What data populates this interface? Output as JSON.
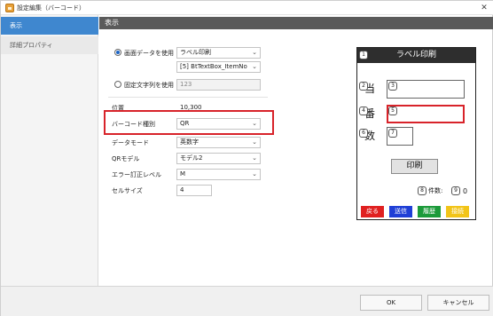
{
  "window": {
    "title": "設定編集（バーコード）",
    "close_glyph": "✕"
  },
  "sidebar": {
    "items": [
      {
        "label": "表示"
      },
      {
        "label": "詳細プロパティ"
      }
    ]
  },
  "section": {
    "title": "表示"
  },
  "form": {
    "use_screen_data": {
      "label": "画面データを使用",
      "selected": true,
      "screen_value": "ラベル印刷",
      "item_value": "[5] BtTextBox_ItemNo"
    },
    "use_fixed_string": {
      "label": "固定文字列を使用",
      "selected": false,
      "value": "123"
    },
    "position": {
      "label": "位置",
      "value": "10,300"
    },
    "barcode_type": {
      "label": "バーコード種別",
      "value": "QR"
    },
    "data_mode": {
      "label": "データモード",
      "value": "英数字"
    },
    "qr_model": {
      "label": "QRモデル",
      "value": "モデル2"
    },
    "error_correction": {
      "label": "エラー訂正レベル",
      "value": "M"
    },
    "cell_size": {
      "label": "セルサイズ",
      "value": "4"
    },
    "caret": "⌄"
  },
  "preview": {
    "title": "ラベル印刷",
    "header_num": "1",
    "rows": [
      {
        "num_label": "2",
        "label": "当",
        "num_box": "3"
      },
      {
        "num_label": "4",
        "label": "番",
        "num_box": "5"
      },
      {
        "num_label": "6",
        "label": "数",
        "num_box": "7"
      }
    ],
    "print_label": "印刷",
    "count_num": "8",
    "count_label": "件数:",
    "count_value_num": "9",
    "count_value": "0",
    "footer_buttons": [
      {
        "label": "戻る",
        "color": "#e02020"
      },
      {
        "label": "送信",
        "color": "#1f3fd6"
      },
      {
        "label": "履歴",
        "color": "#1c9a3a"
      },
      {
        "label": "接続",
        "color": "#f2c418"
      }
    ]
  },
  "footer": {
    "ok_label": "OK",
    "cancel_label": "キャンセル"
  },
  "colors": {
    "accent": "#3f87cf",
    "highlight": "#d8232a",
    "section_bar": "#5a5a5a"
  }
}
